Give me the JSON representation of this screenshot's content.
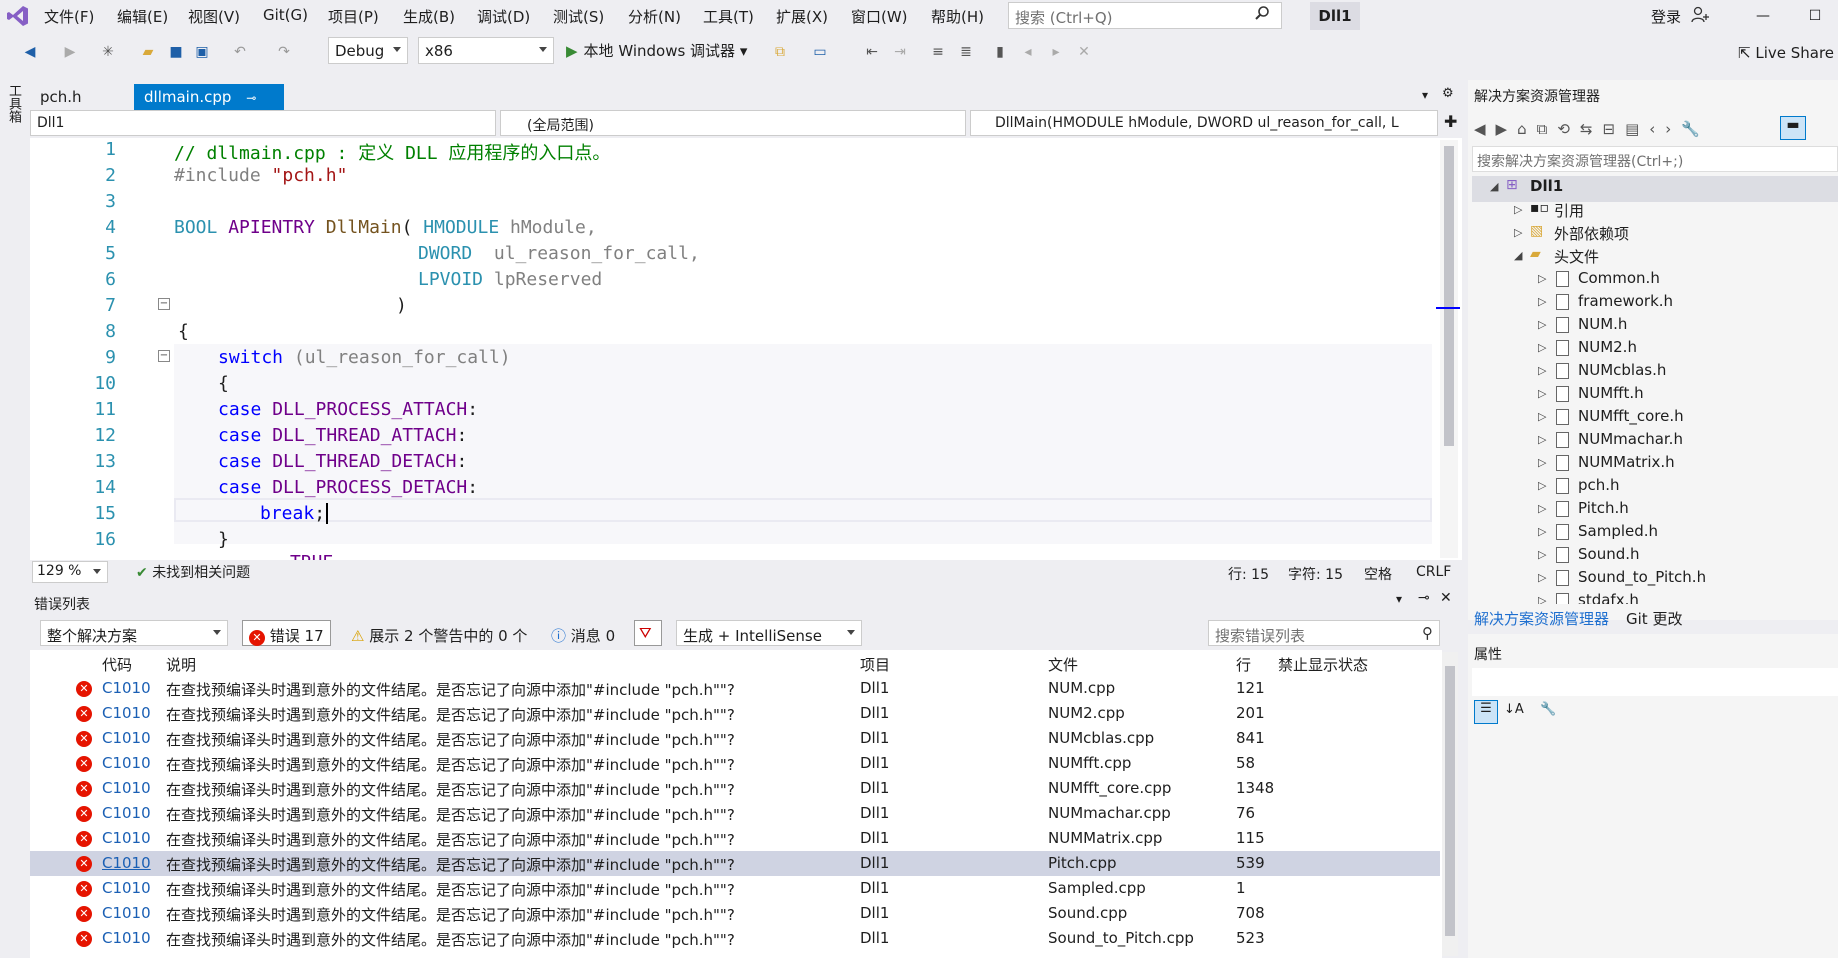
{
  "menu": {
    "items": [
      "文件(F)",
      "编辑(E)",
      "视图(V)",
      "Git(G)",
      "项目(P)",
      "生成(B)",
      "调试(D)",
      "测试(S)",
      "分析(N)",
      "工具(T)",
      "扩展(X)",
      "窗口(W)",
      "帮助(H)"
    ],
    "search_placeholder": "搜索 (Ctrl+Q)",
    "solution_name": "Dll1",
    "login": "登录"
  },
  "toolbar": {
    "config": "Debug",
    "platform": "x86",
    "run_label": "本地 Windows 调试器",
    "live_share": "Live Share"
  },
  "toolbox_label": "工具箱",
  "tabs": [
    {
      "label": "pch.h"
    },
    {
      "label": "dllmain.cpp",
      "pin": "⊸",
      "close": "✕"
    }
  ],
  "navbar": {
    "project": "Dll1",
    "scope": "(全局范围)",
    "member": "DllMain(HMODULE hModule, DWORD ul_reason_for_call, L"
  },
  "editor": {
    "line_numbers": [
      "1",
      "2",
      "3",
      "4",
      "5",
      "6",
      "7",
      "8",
      "9",
      "10",
      "11",
      "12",
      "13",
      "14",
      "15",
      "16"
    ],
    "code": {
      "l1": "// dllmain.cpp : 定义 DLL 应用程序的入口点。",
      "l2_kw": "#include",
      "l2_str": "\"pch.h\"",
      "l4_t1": "BOOL",
      "l4_t2": "APIENTRY",
      "l4_fn": "DllMain",
      "l4_p": "(",
      "l4_t3": "HMODULE",
      "l4_a": "hModule,",
      "l5_t": "DWORD",
      "l5_a": "ul_reason_for_call,",
      "l6_t": "LPVOID",
      "l6_a": "lpReserved",
      "l7": ")",
      "l8": "{",
      "l9_kw": "switch",
      "l9_a": "(ul_reason_for_call)",
      "l10": "{",
      "l11_kw": "case",
      "l11_m": "DLL_PROCESS_ATTACH",
      "l12_kw": "case",
      "l12_m": "DLL_THREAD_ATTACH",
      "l13_kw": "case",
      "l13_m": "DLL_THREAD_DETACH",
      "l14_kw": "case",
      "l14_m": "DLL_PROCESS_DETACH",
      "colon": ":",
      "l15_kw": "break",
      "l15_s": ";",
      "l16": "}",
      "l17_partial": "TRUE"
    },
    "fold_minus": "−"
  },
  "status": {
    "zoom": "129 %",
    "issues": "未找到相关问题",
    "line": "行: 15",
    "char": "字符: 15",
    "spaces": "空格",
    "eol": "CRLF"
  },
  "error_list": {
    "title": "错误列表",
    "scope": "整个解决方案",
    "errors_label": "错误 17",
    "warnings_label": "展示 2 个警告中的 0 个",
    "messages_label": "消息 0",
    "build_filter": "生成 + IntelliSense",
    "search_placeholder": "搜索错误列表",
    "columns": [
      "代码",
      "说明",
      "项目",
      "文件",
      "行",
      "禁止显示状态"
    ],
    "rows": [
      {
        "code": "C1010",
        "desc": "在查找预编译头时遇到意外的文件结尾。是否忘记了向源中添加\"#include \"pch.h\"\"?",
        "project": "Dll1",
        "file": "NUM.cpp",
        "line": "121"
      },
      {
        "code": "C1010",
        "desc": "在查找预编译头时遇到意外的文件结尾。是否忘记了向源中添加\"#include \"pch.h\"\"?",
        "project": "Dll1",
        "file": "NUM2.cpp",
        "line": "201"
      },
      {
        "code": "C1010",
        "desc": "在查找预编译头时遇到意外的文件结尾。是否忘记了向源中添加\"#include \"pch.h\"\"?",
        "project": "Dll1",
        "file": "NUMcblas.cpp",
        "line": "841"
      },
      {
        "code": "C1010",
        "desc": "在查找预编译头时遇到意外的文件结尾。是否忘记了向源中添加\"#include \"pch.h\"\"?",
        "project": "Dll1",
        "file": "NUMfft.cpp",
        "line": "58"
      },
      {
        "code": "C1010",
        "desc": "在查找预编译头时遇到意外的文件结尾。是否忘记了向源中添加\"#include \"pch.h\"\"?",
        "project": "Dll1",
        "file": "NUMfft_core.cpp",
        "line": "1348"
      },
      {
        "code": "C1010",
        "desc": "在查找预编译头时遇到意外的文件结尾。是否忘记了向源中添加\"#include \"pch.h\"\"?",
        "project": "Dll1",
        "file": "NUMmachar.cpp",
        "line": "76"
      },
      {
        "code": "C1010",
        "desc": "在查找预编译头时遇到意外的文件结尾。是否忘记了向源中添加\"#include \"pch.h\"\"?",
        "project": "Dll1",
        "file": "NUMMatrix.cpp",
        "line": "115"
      },
      {
        "code": "C1010",
        "desc": "在查找预编译头时遇到意外的文件结尾。是否忘记了向源中添加\"#include \"pch.h\"\"?",
        "project": "Dll1",
        "file": "Pitch.cpp",
        "line": "539"
      },
      {
        "code": "C1010",
        "desc": "在查找预编译头时遇到意外的文件结尾。是否忘记了向源中添加\"#include \"pch.h\"\"?",
        "project": "Dll1",
        "file": "Sampled.cpp",
        "line": "1"
      },
      {
        "code": "C1010",
        "desc": "在查找预编译头时遇到意外的文件结尾。是否忘记了向源中添加\"#include \"pch.h\"\"?",
        "project": "Dll1",
        "file": "Sound.cpp",
        "line": "708"
      },
      {
        "code": "C1010",
        "desc": "在查找预编译头时遇到意外的文件结尾。是否忘记了向源中添加\"#include \"pch.h\"\"?",
        "project": "Dll1",
        "file": "Sound_to_Pitch.cpp",
        "line": "523"
      }
    ]
  },
  "solution_explorer": {
    "title": "解决方案资源管理器",
    "search_placeholder": "搜索解决方案资源管理器(Ctrl+;)",
    "root": "Dll1",
    "nodes": [
      "引用",
      "外部依赖项",
      "头文件"
    ],
    "headers": [
      "Common.h",
      "framework.h",
      "NUM.h",
      "NUM2.h",
      "NUMcblas.h",
      "NUMfft.h",
      "NUMfft_core.h",
      "NUMmachar.h",
      "NUMMatrix.h",
      "pch.h",
      "Pitch.h",
      "Sampled.h",
      "Sound.h",
      "Sound_to_Pitch.h",
      "stdafx.h"
    ],
    "tabs": [
      "解决方案资源管理器",
      "Git 更改"
    ],
    "props_title": "属性"
  },
  "colors": {
    "accent": "#007acc",
    "error": "#e51400",
    "selected_row": "#cfd3e2"
  }
}
